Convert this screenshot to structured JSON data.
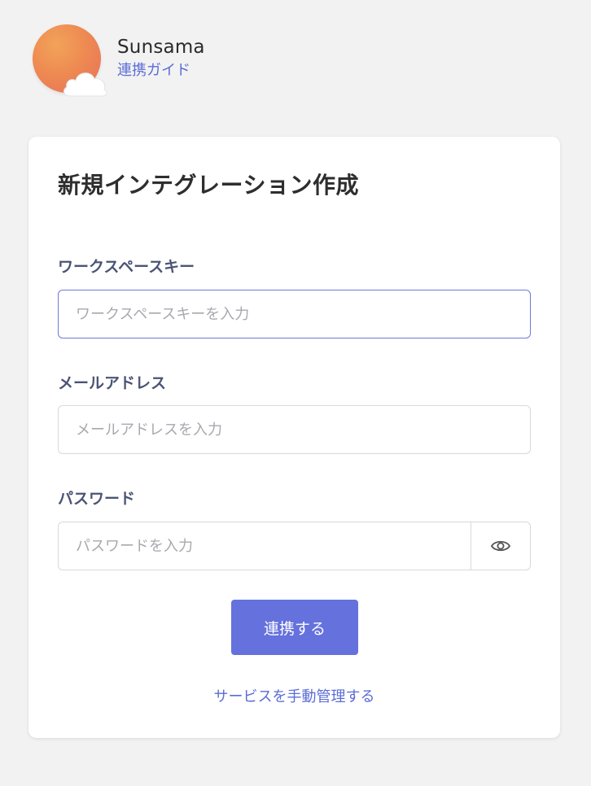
{
  "app": {
    "name": "Sunsama",
    "guide_link": "連携ガイド",
    "logo_icon": "sun-cloud-logo"
  },
  "form": {
    "title": "新規インテグレーション作成",
    "workspace_key": {
      "label": "ワークスペースキー",
      "placeholder": "ワークスペースキーを入力",
      "value": ""
    },
    "email": {
      "label": "メールアドレス",
      "placeholder": "メールアドレスを入力",
      "value": ""
    },
    "password": {
      "label": "パスワード",
      "placeholder": "パスワードを入力",
      "value": "",
      "toggle_icon": "eye-icon"
    },
    "submit_label": "連携する",
    "manual_link": "サービスを手動管理する"
  },
  "colors": {
    "accent": "#6571dc",
    "link": "#5b6dd6",
    "label": "#4b5475",
    "background": "#f2f2f2",
    "logo_sun": "#ee8a52"
  }
}
